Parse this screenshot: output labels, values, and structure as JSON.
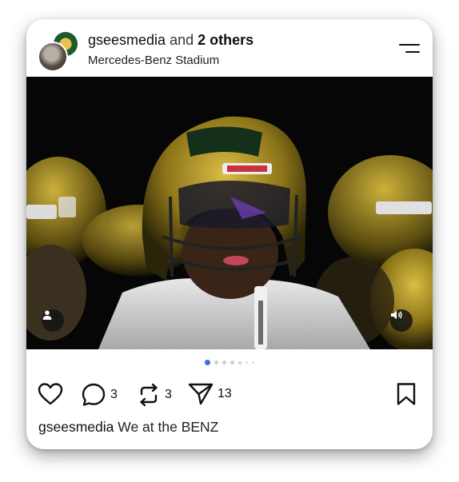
{
  "post": {
    "author": "gseesmedia",
    "coauthor_connector": "and",
    "coauthor_count_label": "2 others",
    "location": "Mercedes-Benz Stadium",
    "image_alt": "Football players in green and gold helmets",
    "carousel": {
      "total": 7,
      "active_index": 0
    }
  },
  "actions": {
    "like_icon": "heart-icon",
    "comment_icon": "comment-icon",
    "comment_count": "3",
    "repost_icon": "repost-icon",
    "repost_count": "3",
    "share_icon": "share-icon",
    "share_count": "13",
    "bookmark_icon": "bookmark-icon"
  },
  "caption": {
    "user": "gseesmedia",
    "text": "We at the BENZ"
  },
  "overlays": {
    "tag_icon": "person-icon",
    "volume_icon": "volume-icon"
  },
  "colors": {
    "accent": "#3d6fe0",
    "helmet_gold": "#c9a52a",
    "helmet_green": "#1c3a1f"
  }
}
